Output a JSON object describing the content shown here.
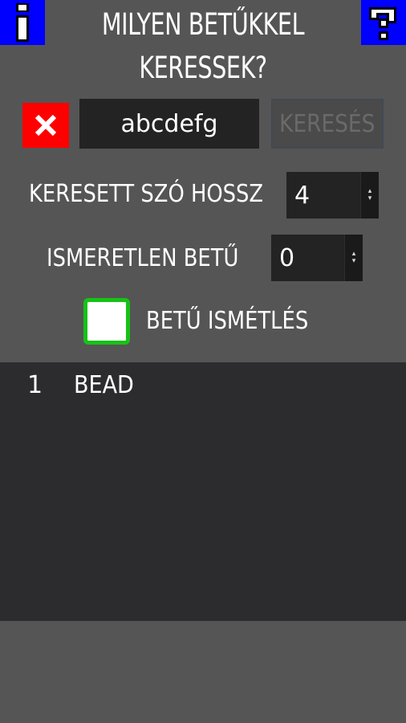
{
  "header": {
    "title_line1": "MILYEN BETŰKKEL",
    "title_line2": "KERESSEK?",
    "info_icon": "info-icon",
    "help_icon": "help-icon"
  },
  "search": {
    "clear_icon": "close-icon",
    "letters_value": "abcdefg",
    "search_label": "KERESÉS"
  },
  "options": {
    "word_length_label": "KERESETT SZÓ HOSSZ",
    "word_length_value": "4",
    "unknown_letter_label": "ISMERETLEN BETŰ",
    "unknown_letter_value": "0",
    "repeat_label": "BETŰ ISMÉTLÉS",
    "repeat_checked": false
  },
  "results": [
    {
      "index": "1",
      "word": "BEAD"
    }
  ],
  "colors": {
    "background": "#555555",
    "icon_blue": "#0000ff",
    "clear_red": "#ff0000",
    "checkbox_green": "#16c216",
    "panel_dark": "#2c2c2f"
  }
}
